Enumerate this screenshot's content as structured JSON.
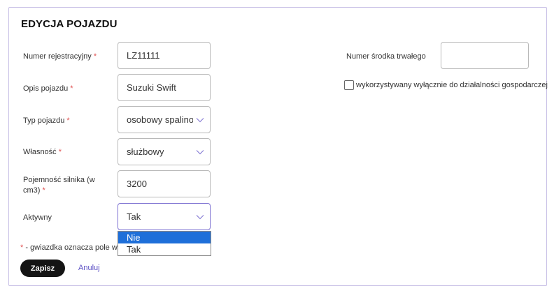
{
  "form": {
    "title": "EDYCJA POJAZDU",
    "required_mark": "*",
    "registration": {
      "label": "Numer rejestracyjny",
      "value": "LZ11111"
    },
    "description": {
      "label": "Opis pojazdu",
      "value": "Suzuki Swift"
    },
    "vehicle_type": {
      "label": "Typ pojazdu",
      "value": "osobowy spalinowy"
    },
    "ownership": {
      "label": "Własność",
      "value": "służbowy"
    },
    "engine": {
      "label": "Pojemność silnika (w cm3)",
      "value": "3200"
    },
    "active": {
      "label": "Aktywny",
      "value": "Tak",
      "options": [
        "Nie",
        "Tak"
      ],
      "highlighted_option": "Nie"
    },
    "asset_number": {
      "label": "Numer środka trwałego",
      "value": ""
    },
    "business_only": {
      "label": "wykorzystywany wyłącznie do działalności gospodarczej",
      "checked": false
    },
    "required_note": "- gwiazdka oznacza pole wy",
    "save_label": "Zapisz",
    "cancel_label": "Anuluj"
  },
  "colors": {
    "accent": "#7b6fd1",
    "required": "#e05151",
    "highlight": "#1e6fd9",
    "save_button": "#141414",
    "link": "#5b4fc4"
  },
  "icons": {
    "select_arrow": "chevron-down-icon"
  }
}
